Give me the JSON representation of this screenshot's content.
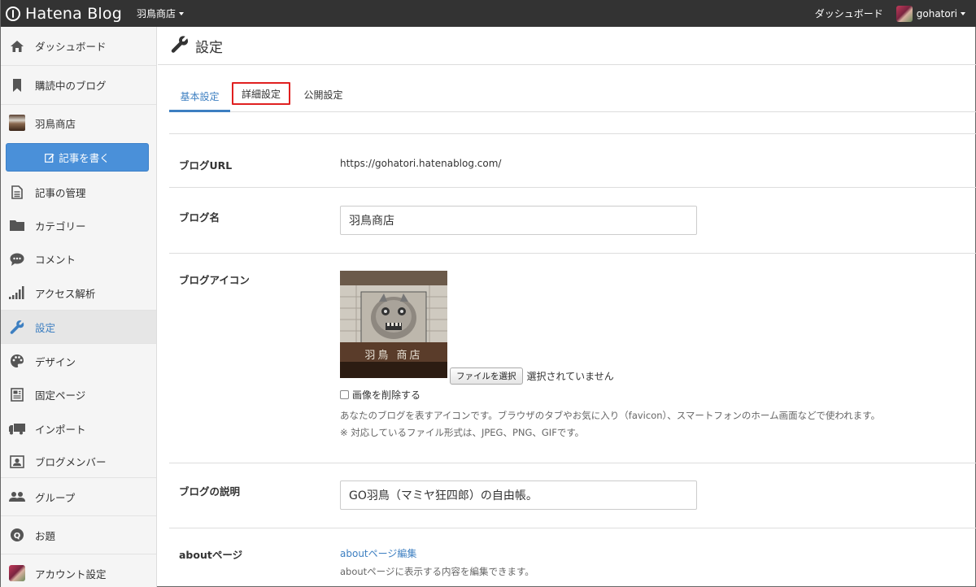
{
  "topbar": {
    "logo_text": "Hatena Blog",
    "blog_name": "羽鳥商店",
    "dashboard": "ダッシュボード",
    "user": "gohatori"
  },
  "sidebar": {
    "items": [
      {
        "label": "ダッシュボード",
        "icon": "home-icon"
      },
      {
        "label": "購読中のブログ",
        "icon": "bookmark-icon"
      },
      {
        "label": "羽鳥商店",
        "icon": "blog-thumbnail"
      },
      {
        "label": "記事の管理",
        "icon": "document-icon"
      },
      {
        "label": "カテゴリー",
        "icon": "folder-icon"
      },
      {
        "label": "コメント",
        "icon": "comment-icon"
      },
      {
        "label": "アクセス解析",
        "icon": "signal-bars-icon"
      },
      {
        "label": "設定",
        "icon": "wrench-icon"
      },
      {
        "label": "デザイン",
        "icon": "palette-icon"
      },
      {
        "label": "固定ページ",
        "icon": "page-icon"
      },
      {
        "label": "インポート",
        "icon": "truck-icon"
      },
      {
        "label": "ブログメンバー",
        "icon": "member-card-icon"
      },
      {
        "label": "グループ",
        "icon": "group-icon"
      },
      {
        "label": "お題",
        "icon": "q-icon"
      },
      {
        "label": "アカウント設定",
        "icon": "account-avatar"
      }
    ],
    "write_button": "記事を書く"
  },
  "page": {
    "title": "設定",
    "tabs": [
      {
        "label": "基本設定",
        "active": true
      },
      {
        "label": "詳細設定",
        "highlighted": true
      },
      {
        "label": "公開設定"
      }
    ]
  },
  "settings": {
    "blog_url_label": "ブログURL",
    "blog_url_value": "https://gohatori.hatenablog.com/",
    "blog_name_label": "ブログ名",
    "blog_name_value": "羽鳥商店",
    "blog_icon_label": "ブログアイコン",
    "file_button": "ファイルを選択",
    "file_status": "選択されていません",
    "delete_image": "画像を削除する",
    "icon_help": "あなたのブログを表すアイコンです。ブラウザのタブやお気に入り（favicon）、スマートフォンのホーム画面などで使われます。",
    "icon_formats": "※ 対応しているファイル形式は、JPEG、PNG、GIFです。",
    "icon_image_text": "羽鳥 商店",
    "description_label": "ブログの説明",
    "description_value": "GO羽鳥（マミヤ狂四郎）の自由帳。",
    "about_label": "aboutページ",
    "about_link": "aboutページ編集",
    "about_help": "aboutページに表示する内容を編集できます。"
  },
  "colors": {
    "topbar": "#333333",
    "accent": "#3d7fc1",
    "write_button": "#4a90d9",
    "highlight": "#e02020"
  }
}
